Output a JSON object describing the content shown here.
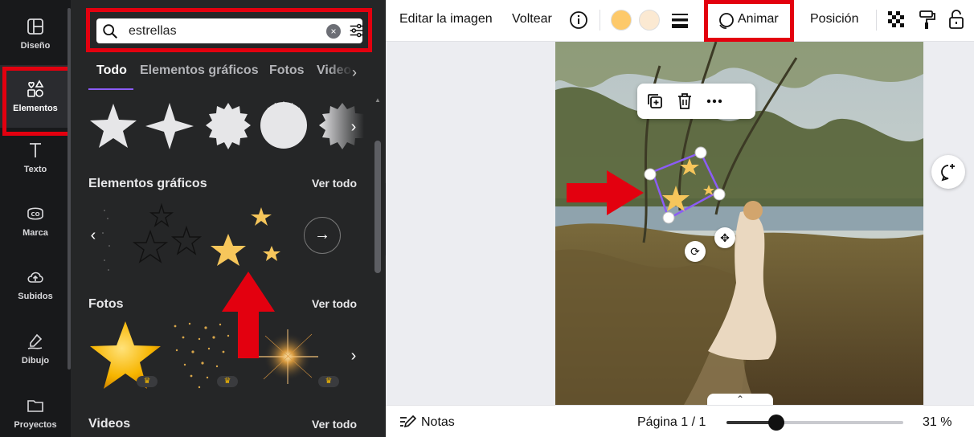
{
  "rail": {
    "items": [
      {
        "label": "Diseño",
        "icon": "layout-icon"
      },
      {
        "label": "Elementos",
        "icon": "shapes-icon"
      },
      {
        "label": "Texto",
        "icon": "text-icon"
      },
      {
        "label": "Marca",
        "icon": "brand-icon"
      },
      {
        "label": "Subidos",
        "icon": "cloud-upload-icon"
      },
      {
        "label": "Dibujo",
        "icon": "draw-icon"
      },
      {
        "label": "Proyectos",
        "icon": "folder-icon"
      }
    ]
  },
  "search": {
    "value": "estrellas",
    "clear": "×"
  },
  "tabs": [
    "Todo",
    "Elementos gráficos",
    "Fotos",
    "Videos"
  ],
  "sections": {
    "graphics": {
      "title": "Elementos gráficos",
      "see_all": "Ver todo"
    },
    "photos": {
      "title": "Fotos",
      "see_all": "Ver todo"
    },
    "videos": {
      "title": "Videos",
      "see_all": "Ver todo"
    }
  },
  "toolbar": {
    "edit_image": "Editar la imagen",
    "flip": "Voltear",
    "animate": "Animar",
    "position": "Posición",
    "swatches": [
      "#fdc96a",
      "#fbe9d2"
    ]
  },
  "footer": {
    "notes": "Notas",
    "page": "Página 1 / 1",
    "zoom": "31 %",
    "zoom_fraction": 0.28
  },
  "colors": {
    "accent": "#8b5cf6",
    "highlight": "#e3000f",
    "star": "#f6c65b"
  }
}
